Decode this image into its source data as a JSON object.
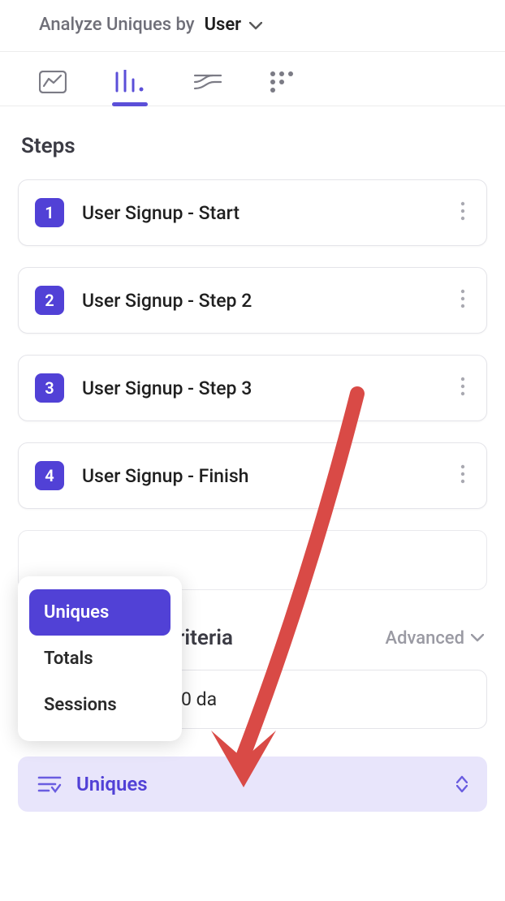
{
  "header": {
    "analyze_label": "Analyze Uniques by",
    "analyze_value": "User"
  },
  "tabs": {
    "active_index": 1
  },
  "steps_section_title": "Steps",
  "steps": [
    {
      "num": "1",
      "label": "User Signup - Start"
    },
    {
      "num": "2",
      "label": "User Signup - Step 2"
    },
    {
      "num": "3",
      "label": "User Signup - Step 3"
    },
    {
      "num": "4",
      "label": "User Signup - Finish"
    }
  ],
  "criteria": {
    "partial_title": "riteria",
    "advanced_label": "Advanced",
    "partial_card_text": "0 da"
  },
  "metric_dropdown": {
    "selected": "Uniques"
  },
  "popup": {
    "options": [
      "Uniques",
      "Totals",
      "Sessions"
    ],
    "selected_index": 0
  }
}
